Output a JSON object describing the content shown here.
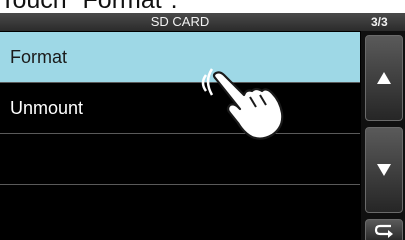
{
  "caption": "Touch \"Format\".",
  "screen": {
    "title": "SD CARD",
    "page_indicator": "3/3"
  },
  "menu": {
    "items": [
      {
        "label": "Format",
        "selected": true
      },
      {
        "label": "Unmount",
        "selected": false
      },
      {
        "label": "",
        "selected": false
      },
      {
        "label": "",
        "selected": false
      }
    ]
  },
  "buttons": {
    "up_icon": "triangle-up-icon",
    "down_icon": "triangle-down-icon",
    "back_icon": "return-arrow-icon"
  },
  "colors": {
    "selected_row": "#9ed8e6",
    "background": "#000000",
    "title_bar": "#3a3a3a"
  }
}
